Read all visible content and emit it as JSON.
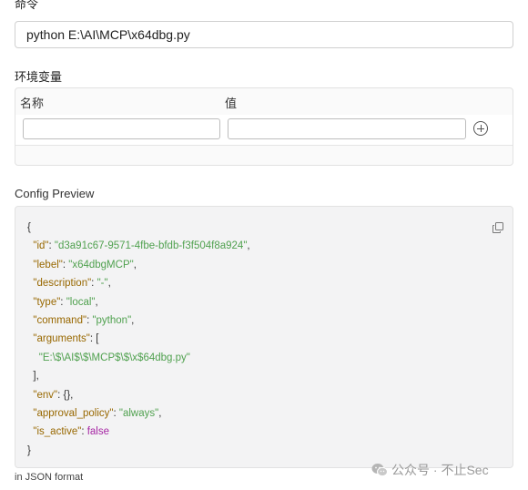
{
  "command": {
    "label": "命令",
    "value": "python E:\\AI\\MCP\\x64dbg.py"
  },
  "env": {
    "label": "环境变量",
    "col_name": "名称",
    "col_value": "值",
    "name_value": "",
    "value_value": ""
  },
  "preview": {
    "label": "Config Preview",
    "format_note": "in JSON format",
    "json": {
      "open": "{",
      "id_key": "\"id\"",
      "id_val": "\"d3a91c67-9571-4fbe-bfdb-f3f504f8a924\"",
      "lebel_key": "\"lebel\"",
      "lebel_val": "\"x64dbgMCP\"",
      "description_key": "\"description\"",
      "description_val": "\"-\"",
      "type_key": "\"type\"",
      "type_val": "\"local\"",
      "command_key": "\"command\"",
      "command_val": "\"python\"",
      "arguments_key": "\"arguments\"",
      "arguments_open": "[",
      "arguments_item": "\"E:\\$\\AI$\\$\\MCP$\\$\\x$64dbg.py\"",
      "arguments_close": "],",
      "env_key": "\"env\"",
      "env_val": "{},",
      "approval_key": "\"approval_policy\"",
      "approval_val": "\"always\"",
      "active_key": "\"is_active\"",
      "active_val": "false",
      "close": "}"
    }
  },
  "watermark": {
    "text": "公众号 · 不止Sec"
  },
  "colors": {
    "key": "#986801",
    "string": "#50a14f",
    "boolean": "#a626a4"
  }
}
